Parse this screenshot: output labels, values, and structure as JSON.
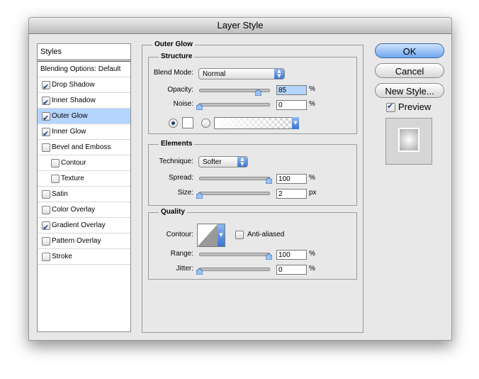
{
  "window": {
    "title": "Layer Style"
  },
  "styles_panel": {
    "header": "Styles",
    "items": [
      {
        "label": "Blending Options: Default",
        "has_checkbox": false,
        "checked": false,
        "selected": false,
        "indent": false
      },
      {
        "label": "Drop Shadow",
        "has_checkbox": true,
        "checked": true,
        "selected": false,
        "indent": false
      },
      {
        "label": "Inner Shadow",
        "has_checkbox": true,
        "checked": true,
        "selected": false,
        "indent": false
      },
      {
        "label": "Outer Glow",
        "has_checkbox": true,
        "checked": true,
        "selected": true,
        "indent": false
      },
      {
        "label": "Inner Glow",
        "has_checkbox": true,
        "checked": true,
        "selected": false,
        "indent": false
      },
      {
        "label": "Bevel and Emboss",
        "has_checkbox": true,
        "checked": false,
        "selected": false,
        "indent": false
      },
      {
        "label": "Contour",
        "has_checkbox": true,
        "checked": false,
        "selected": false,
        "indent": true
      },
      {
        "label": "Texture",
        "has_checkbox": true,
        "checked": false,
        "selected": false,
        "indent": true
      },
      {
        "label": "Satin",
        "has_checkbox": true,
        "checked": false,
        "selected": false,
        "indent": false
      },
      {
        "label": "Color Overlay",
        "has_checkbox": true,
        "checked": false,
        "selected": false,
        "indent": false
      },
      {
        "label": "Gradient Overlay",
        "has_checkbox": true,
        "checked": true,
        "selected": false,
        "indent": false
      },
      {
        "label": "Pattern Overlay",
        "has_checkbox": true,
        "checked": false,
        "selected": false,
        "indent": false
      },
      {
        "label": "Stroke",
        "has_checkbox": true,
        "checked": false,
        "selected": false,
        "indent": false
      }
    ]
  },
  "outer_glow": {
    "title": "Outer Glow",
    "structure": {
      "title": "Structure",
      "blend_mode_label": "Blend Mode:",
      "blend_mode_value": "Normal",
      "opacity_label": "Opacity:",
      "opacity_value": "85",
      "opacity_fraction": 0.85,
      "noise_label": "Noise:",
      "noise_value": "0",
      "noise_fraction": 0.0,
      "percent": "%"
    },
    "elements": {
      "title": "Elements",
      "technique_label": "Technique:",
      "technique_value": "Softer",
      "spread_label": "Spread:",
      "spread_value": "100",
      "spread_fraction": 1.0,
      "size_label": "Size:",
      "size_value": "2",
      "size_fraction": 0.0,
      "percent": "%",
      "px": "px"
    },
    "quality": {
      "title": "Quality",
      "contour_label": "Contour:",
      "anti_aliased_label": "Anti-aliased",
      "anti_aliased_checked": false,
      "range_label": "Range:",
      "range_value": "100",
      "range_fraction": 1.0,
      "jitter_label": "Jitter:",
      "jitter_value": "0",
      "jitter_fraction": 0.0,
      "percent": "%"
    }
  },
  "buttons": {
    "ok": "OK",
    "cancel": "Cancel",
    "new_style": "New Style...",
    "preview_label": "Preview",
    "preview_checked": true
  },
  "colors": {
    "selection": "#b5d5ff",
    "default_button": "#6fa6ee",
    "window_bg": "#e8e8e8"
  }
}
